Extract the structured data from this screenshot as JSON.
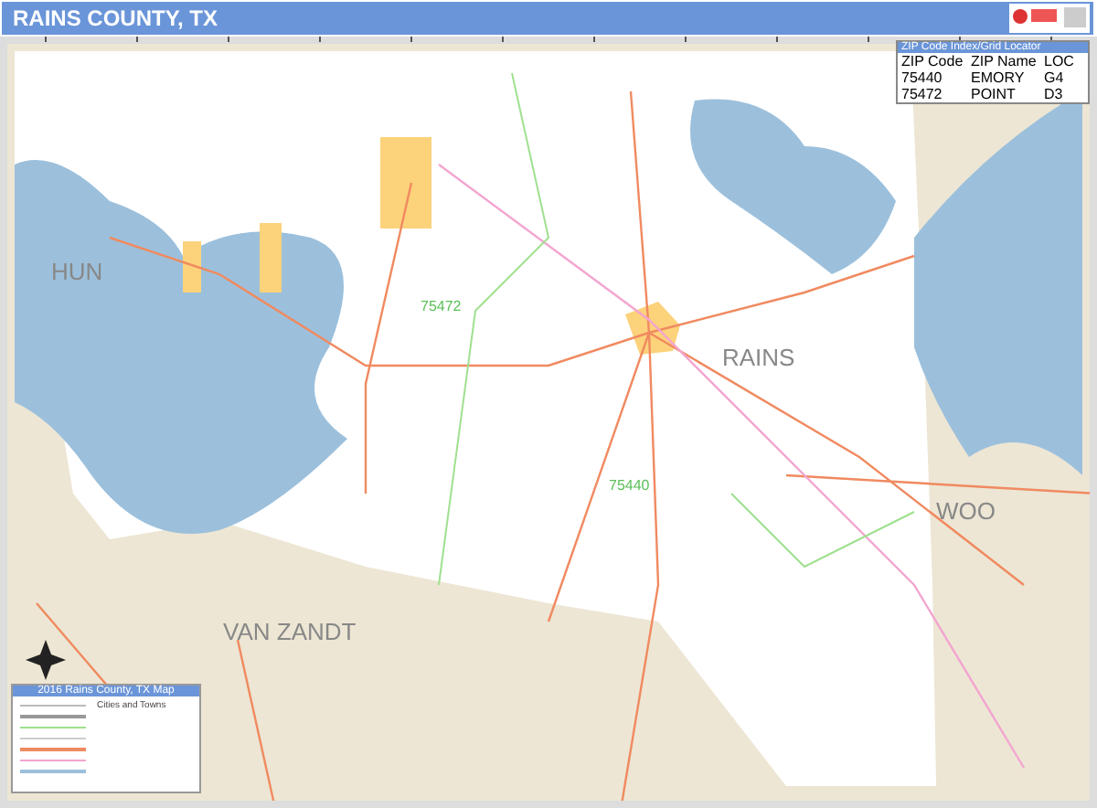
{
  "title": "RAINS COUNTY, TX",
  "zip_index": {
    "title": "ZIP Code Index/Grid Locator",
    "columns": [
      "ZIP Code",
      "ZIP Name",
      "LOC"
    ],
    "rows": [
      [
        "75440",
        "EMORY",
        "G4"
      ],
      [
        "75472",
        "POINT",
        "D3"
      ]
    ]
  },
  "map_labels": [
    {
      "text": "HUN",
      "kind": "county"
    },
    {
      "text": "RAINS",
      "kind": "county"
    },
    {
      "text": "WOO",
      "kind": "county"
    },
    {
      "text": "VAN ZANDT",
      "kind": "county"
    },
    {
      "text": "75472",
      "kind": "zip"
    },
    {
      "text": "75440",
      "kind": "zip"
    }
  ],
  "legend": {
    "title": "2016 Rains County, TX Map",
    "subtitle": "Cities and Towns"
  }
}
